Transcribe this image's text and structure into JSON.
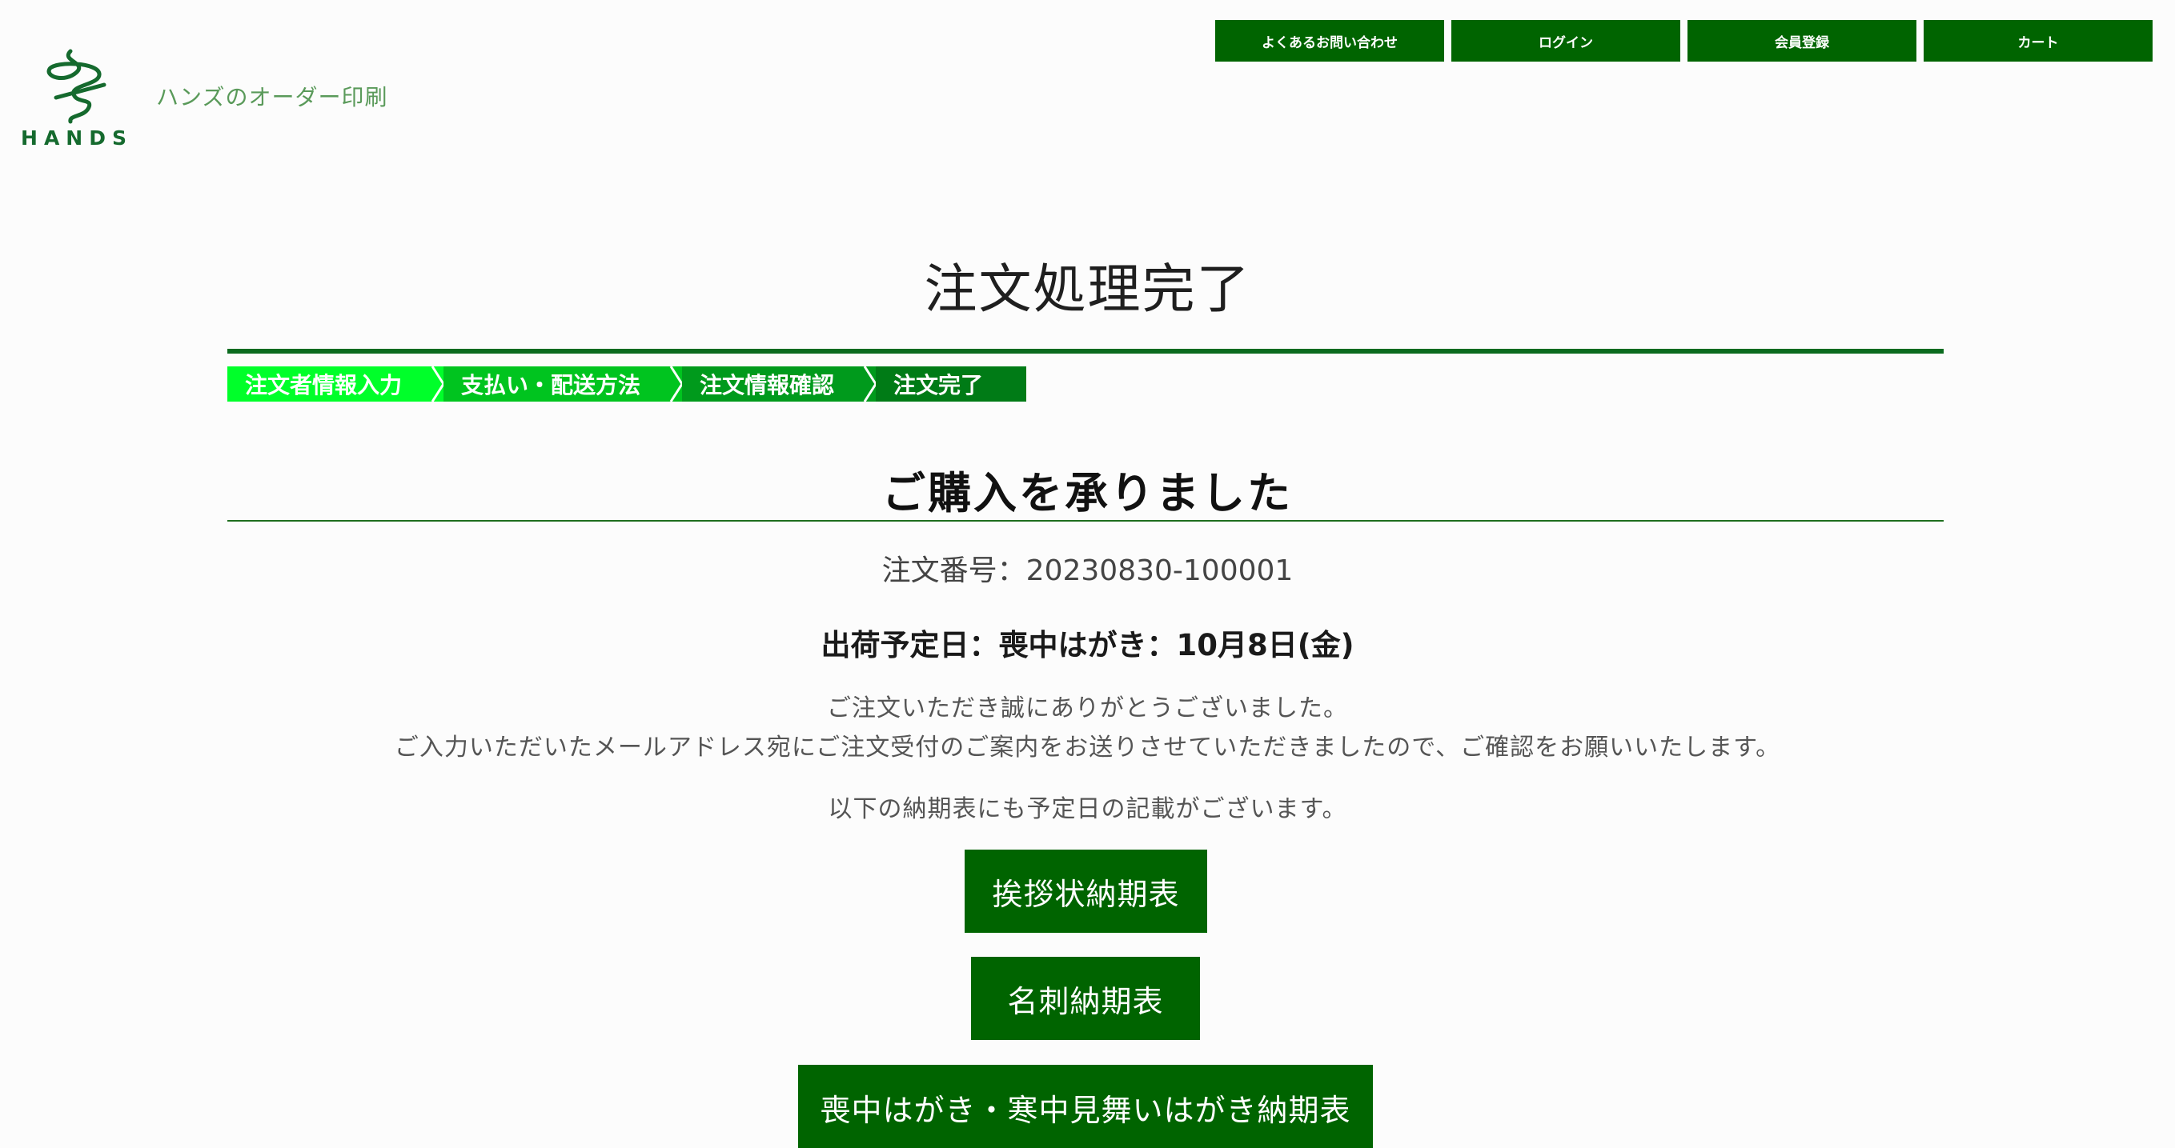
{
  "header": {
    "logo_text": "HANDS",
    "site_title": "ハンズのオーダー印刷",
    "nav": [
      "よくあるお問い合わせ",
      "ログイン",
      "会員登録",
      "カート"
    ]
  },
  "page_title": "注文処理完了",
  "steps": [
    "注文者情報入力",
    "支払い・配送方法",
    "注文情報確認",
    "注文完了"
  ],
  "subtitle": "ご購入を承りました",
  "order_number": "注文番号：20230830-100001",
  "ship_date": "出荷予定日：喪中はがき：10月8日(金)",
  "messages": {
    "thanks": "ご注文いただき誠にありがとうございました。",
    "email": "ご入力いただいたメールアドレス宛にご注文受付のご案内をお送りさせていただきましたので、ご確認をお願いいたします。",
    "schedule_note": "以下の納期表にも予定日の記載がございます。"
  },
  "schedule_buttons": [
    "挨拶状納期表",
    "名刺納期表",
    "喪中はがき・寒中見舞いはがき納期表"
  ],
  "colors": {
    "brand_green": "#006400",
    "step_1": "#00ff2a",
    "step_2": "#00c41f",
    "step_3": "#009a1c",
    "step_4": "#007b16"
  }
}
